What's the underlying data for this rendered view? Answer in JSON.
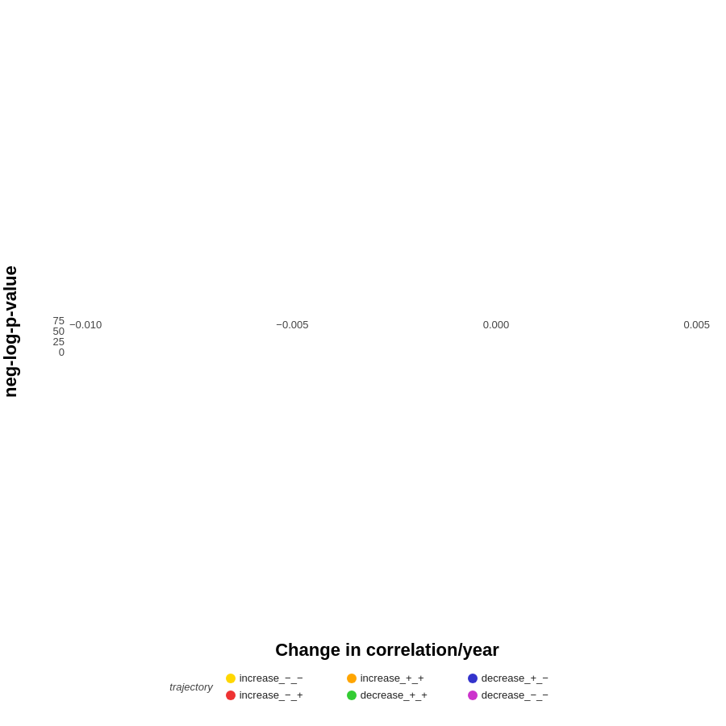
{
  "chart": {
    "title": "",
    "x_axis_label": "Change in correlation/year",
    "y_axis_label": "neg-log-p-value",
    "x_ticks": [
      "-0.010",
      "-0.005",
      "0.000",
      "0.005"
    ],
    "y_ticks": [
      "0",
      "25",
      "50",
      "75"
    ],
    "background_color": "#e8e8e8",
    "grid_color": "#ffffff"
  },
  "legend": {
    "title": "trajectory",
    "items": [
      {
        "label": "increase_−_−",
        "color": "#FFD700",
        "row": 0
      },
      {
        "label": "increase_+_+",
        "color": "#FFA500",
        "row": 0
      },
      {
        "label": "decrease_+_−",
        "color": "#3333CC",
        "row": 0
      },
      {
        "label": "increase_−_+",
        "color": "#EE3333",
        "row": 1
      },
      {
        "label": "decrease_+_+",
        "color": "#33CC33",
        "row": 1
      },
      {
        "label": "decrease_−_−",
        "color": "#CC33CC",
        "row": 1
      }
    ]
  }
}
